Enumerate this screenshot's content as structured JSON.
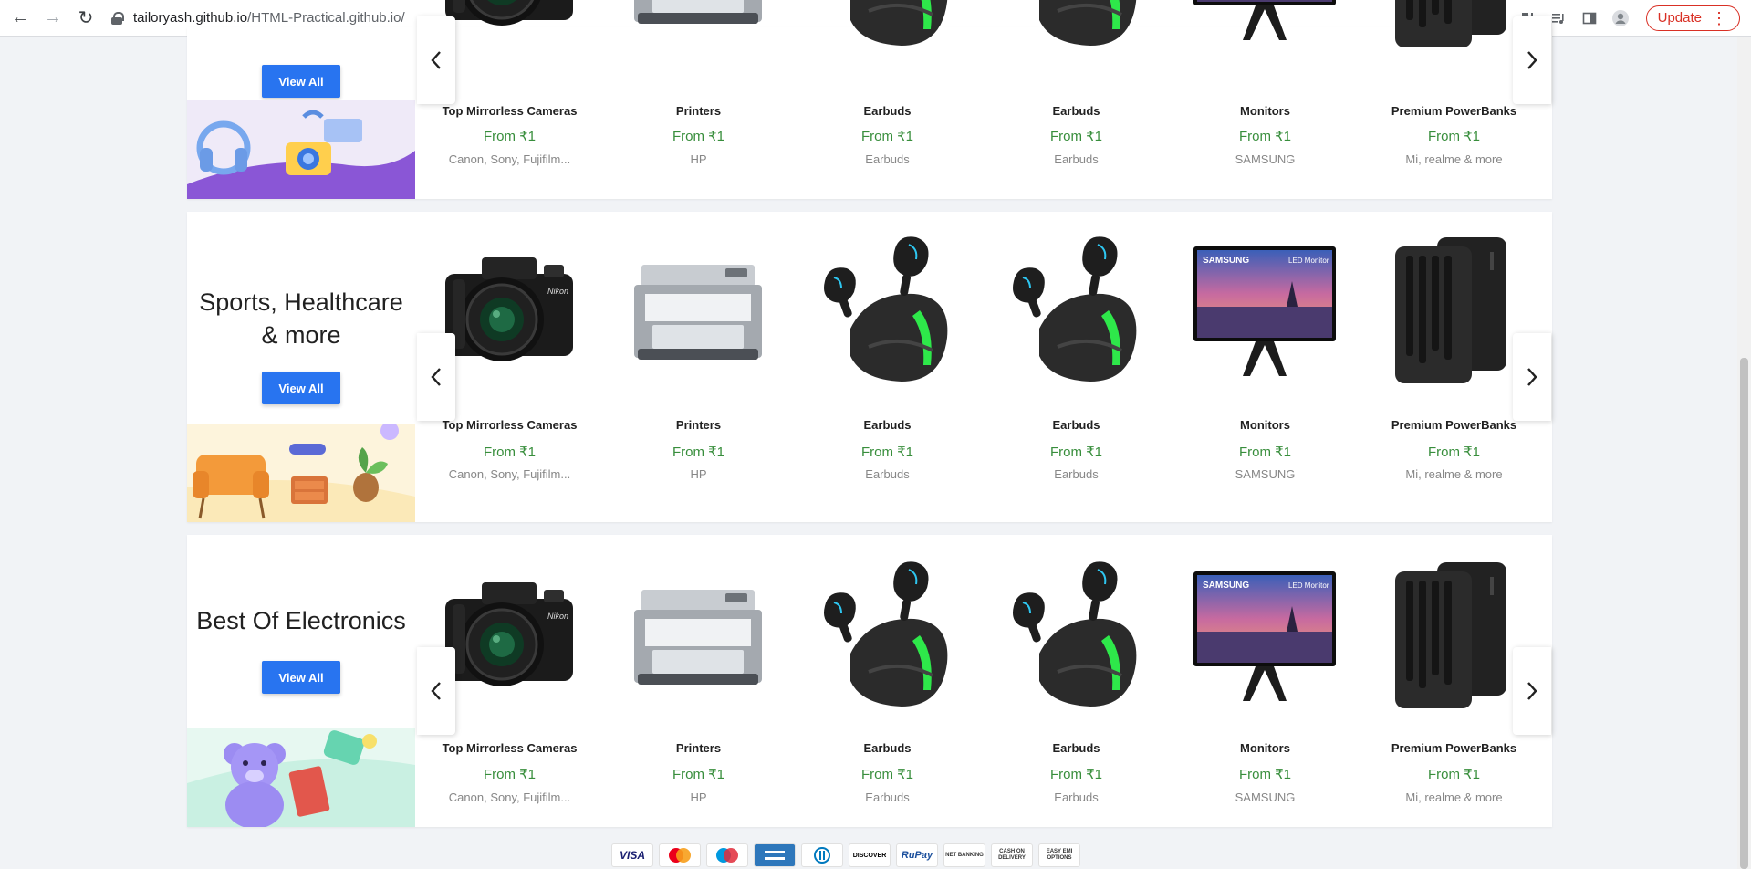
{
  "browser": {
    "url_host": "tailoryash.github.io",
    "url_path": "/HTML-Practical.github.io/",
    "update_label": "Update"
  },
  "sections": [
    {
      "title": "",
      "view_all": "View All",
      "products": [
        {
          "name": "Top Mirrorless Cameras",
          "price": "From ₹1",
          "brand": "Canon, Sony, Fujifilm..."
        },
        {
          "name": "Printers",
          "price": "From ₹1",
          "brand": "HP"
        },
        {
          "name": "Earbuds",
          "price": "From ₹1",
          "brand": "Earbuds"
        },
        {
          "name": "Earbuds",
          "price": "From ₹1",
          "brand": "Earbuds"
        },
        {
          "name": "Monitors",
          "price": "From ₹1",
          "brand": "SAMSUNG"
        },
        {
          "name": "Premium PowerBanks",
          "price": "From ₹1",
          "brand": "Mi, realme & more"
        }
      ]
    },
    {
      "title_line1": "Sports, Healthcare",
      "title_line2": "& more",
      "view_all": "View All",
      "products": [
        {
          "name": "Top Mirrorless Cameras",
          "price": "From ₹1",
          "brand": "Canon, Sony, Fujifilm..."
        },
        {
          "name": "Printers",
          "price": "From ₹1",
          "brand": "HP"
        },
        {
          "name": "Earbuds",
          "price": "From ₹1",
          "brand": "Earbuds"
        },
        {
          "name": "Earbuds",
          "price": "From ₹1",
          "brand": "Earbuds"
        },
        {
          "name": "Monitors",
          "price": "From ₹1",
          "brand": "SAMSUNG"
        },
        {
          "name": "Premium PowerBanks",
          "price": "From ₹1",
          "brand": "Mi, realme & more"
        }
      ]
    },
    {
      "title": "Best Of Electronics",
      "view_all": "View All",
      "products": [
        {
          "name": "Top Mirrorless Cameras",
          "price": "From ₹1",
          "brand": "Canon, Sony, Fujifilm..."
        },
        {
          "name": "Printers",
          "price": "From ₹1",
          "brand": "HP"
        },
        {
          "name": "Earbuds",
          "price": "From ₹1",
          "brand": "Earbuds"
        },
        {
          "name": "Earbuds",
          "price": "From ₹1",
          "brand": "Earbuds"
        },
        {
          "name": "Monitors",
          "price": "From ₹1",
          "brand": "SAMSUNG"
        },
        {
          "name": "Premium PowerBanks",
          "price": "From ₹1",
          "brand": "Mi, realme & more"
        }
      ]
    }
  ],
  "product_images": [
    "camera",
    "printer",
    "earbuds",
    "earbuds",
    "monitor",
    "powerbank"
  ],
  "image_text": {
    "camera_brand": "Nikon",
    "monitor_brand": "SAMSUNG",
    "monitor_tag": "LED Monitor"
  },
  "payments": [
    "VISA",
    "MASTERCARD",
    "MAESTRO",
    "AMEX",
    "DINERS",
    "DISCOVER",
    "RuPay",
    "NET BANKING",
    "CASH ON DELIVERY",
    "EASY EMI OPTIONS"
  ],
  "payment_text": {
    "visa": "VISA",
    "discover": "DISCOVER",
    "rupay": "RuPay",
    "net_banking": "NET BANKING",
    "cod": "CASH ON DELIVERY",
    "emi": "EASY EMI OPTIONS"
  },
  "colors": {
    "primary": "#2874f0",
    "price": "#388e3c",
    "brand": "#878787",
    "update": "#d93025"
  }
}
